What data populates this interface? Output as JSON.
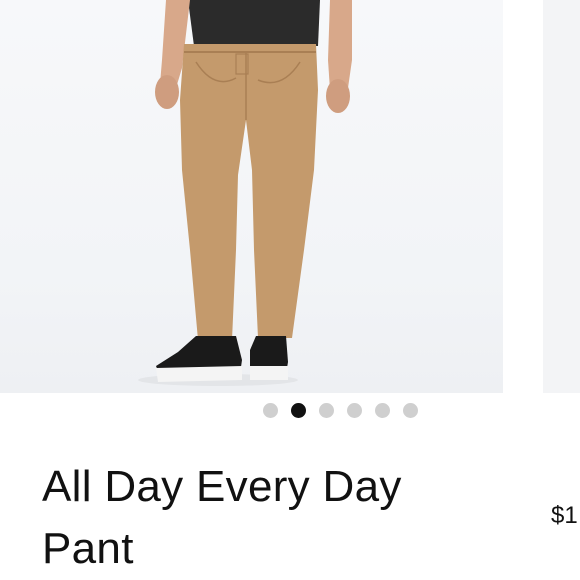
{
  "product": {
    "title": "All Day Every Day Pant",
    "price": "$1",
    "pant_color": "#c49a6c"
  },
  "carousel": {
    "total": 6,
    "active_index": 2
  }
}
